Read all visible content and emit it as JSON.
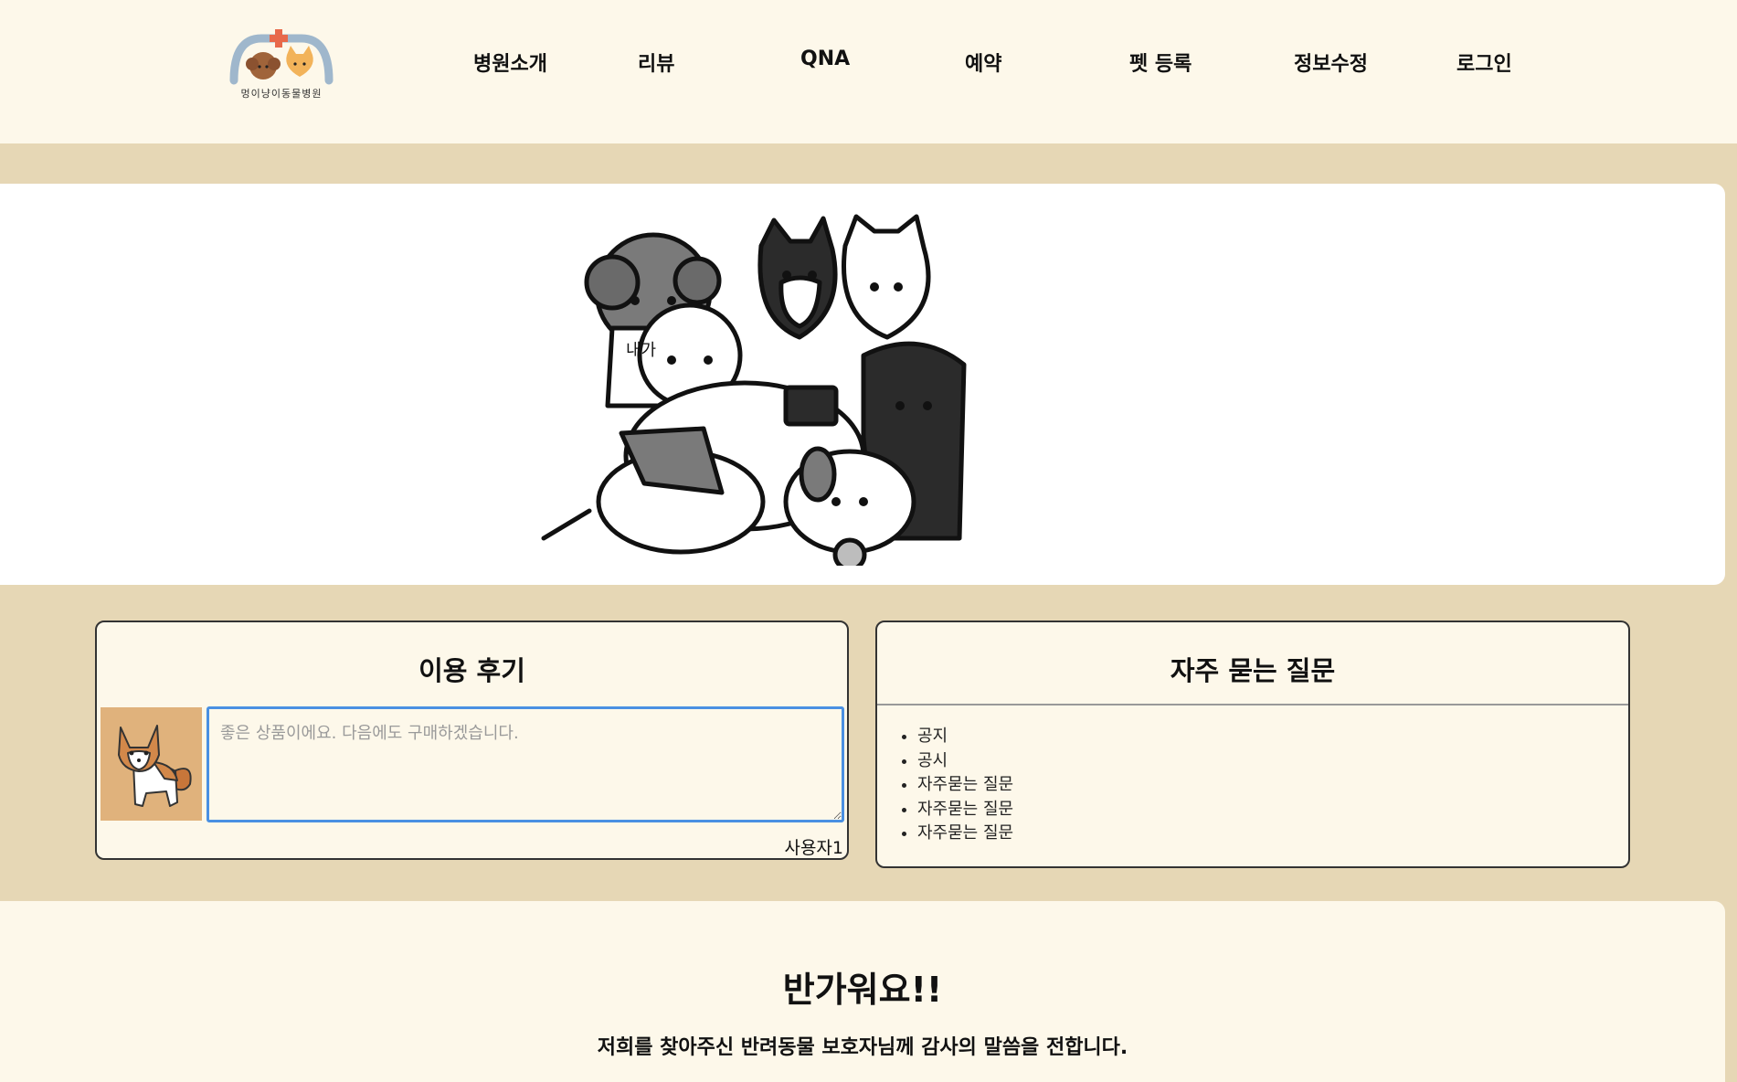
{
  "header": {
    "logo_text": "멍이냥이동물병원",
    "nav": [
      {
        "label": "병원소개"
      },
      {
        "label": "리뷰"
      },
      {
        "label": "QNA"
      },
      {
        "label": "예약"
      },
      {
        "label": "펫 등록"
      },
      {
        "label": "정보수정"
      },
      {
        "label": "로그인"
      }
    ]
  },
  "hero": {
    "image_icon": "dog-group-illustration",
    "shirt_text": "내가"
  },
  "review": {
    "title": "이용 후기",
    "avatar_icon": "corgi-icon",
    "placeholder": "좋은 상품이에요. 다음에도 구매하겠습니다.",
    "user": "사용자1"
  },
  "faq": {
    "title": "자주 묻는 질문",
    "items": [
      "공지",
      "공시",
      "자주묻는 질문",
      "자주묻는 질문",
      "자주묻는 질문"
    ]
  },
  "welcome": {
    "title": "반가워요!!",
    "subtitle": "저희를 찾아주신 반려동물 보호자님께 감사의 말씀을 전합니다."
  },
  "colors": {
    "page_bg": "#e6d7b5",
    "panel_bg": "#fdf8ea",
    "hero_bg": "#ffffff",
    "textarea_border": "#4a90e2",
    "logo_cross": "#e8694a",
    "logo_arch": "#9fb7cc",
    "avatar_bg": "#e0b27c"
  }
}
